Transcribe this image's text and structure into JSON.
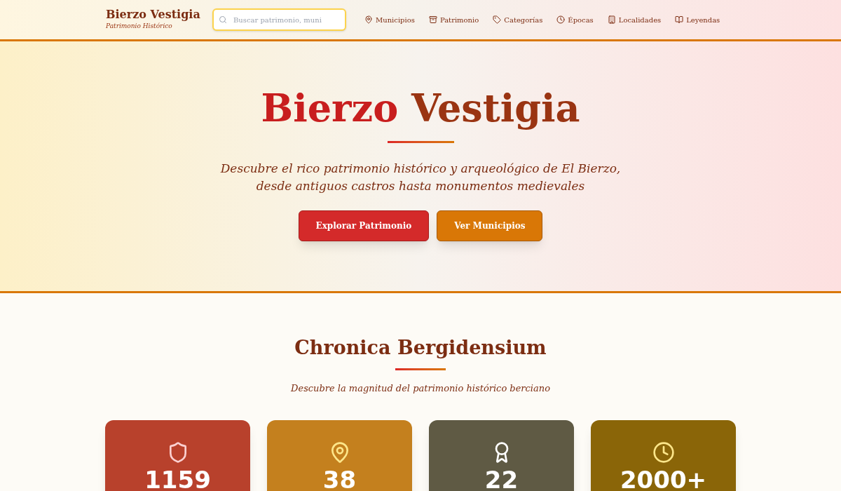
{
  "brand": {
    "title": "Bierzo Vestigia",
    "subtitle": "Patrimonio Histórico"
  },
  "search": {
    "placeholder": "Buscar patrimonio, muni"
  },
  "nav": [
    {
      "kind": "pin",
      "label": "Municipios"
    },
    {
      "kind": "archive",
      "label": "Patrimonio"
    },
    {
      "kind": "tag",
      "label": "Categorías"
    },
    {
      "kind": "clock",
      "label": "Épocas"
    },
    {
      "kind": "building",
      "label": "Localidades"
    },
    {
      "kind": "book",
      "label": "Leyendas"
    }
  ],
  "hero": {
    "title_first": "Bierzo",
    "title_second": "Vestigia",
    "lead": "Descubre el rico patrimonio histórico y arqueológico de El Bierzo,\ndesde antiguos castros hasta monumentos medievales",
    "buttons": [
      {
        "kind": "primary",
        "label": "Explorar Patrimonio"
      },
      {
        "kind": "secondary",
        "label": "Ver Municipios"
      }
    ]
  },
  "stats": {
    "title": "Chronica Bergidensium",
    "subtitle": "Descubre la magnitud del patrimonio histórico berciano",
    "cards": [
      {
        "kind": "shield",
        "value": "1159",
        "color": "#b8412c"
      },
      {
        "kind": "pin",
        "value": "38",
        "color": "#c4801e"
      },
      {
        "kind": "award",
        "value": "22",
        "color": "#5f5a44"
      },
      {
        "kind": "clock",
        "value": "2000+",
        "color": "#8a6508"
      }
    ]
  }
}
